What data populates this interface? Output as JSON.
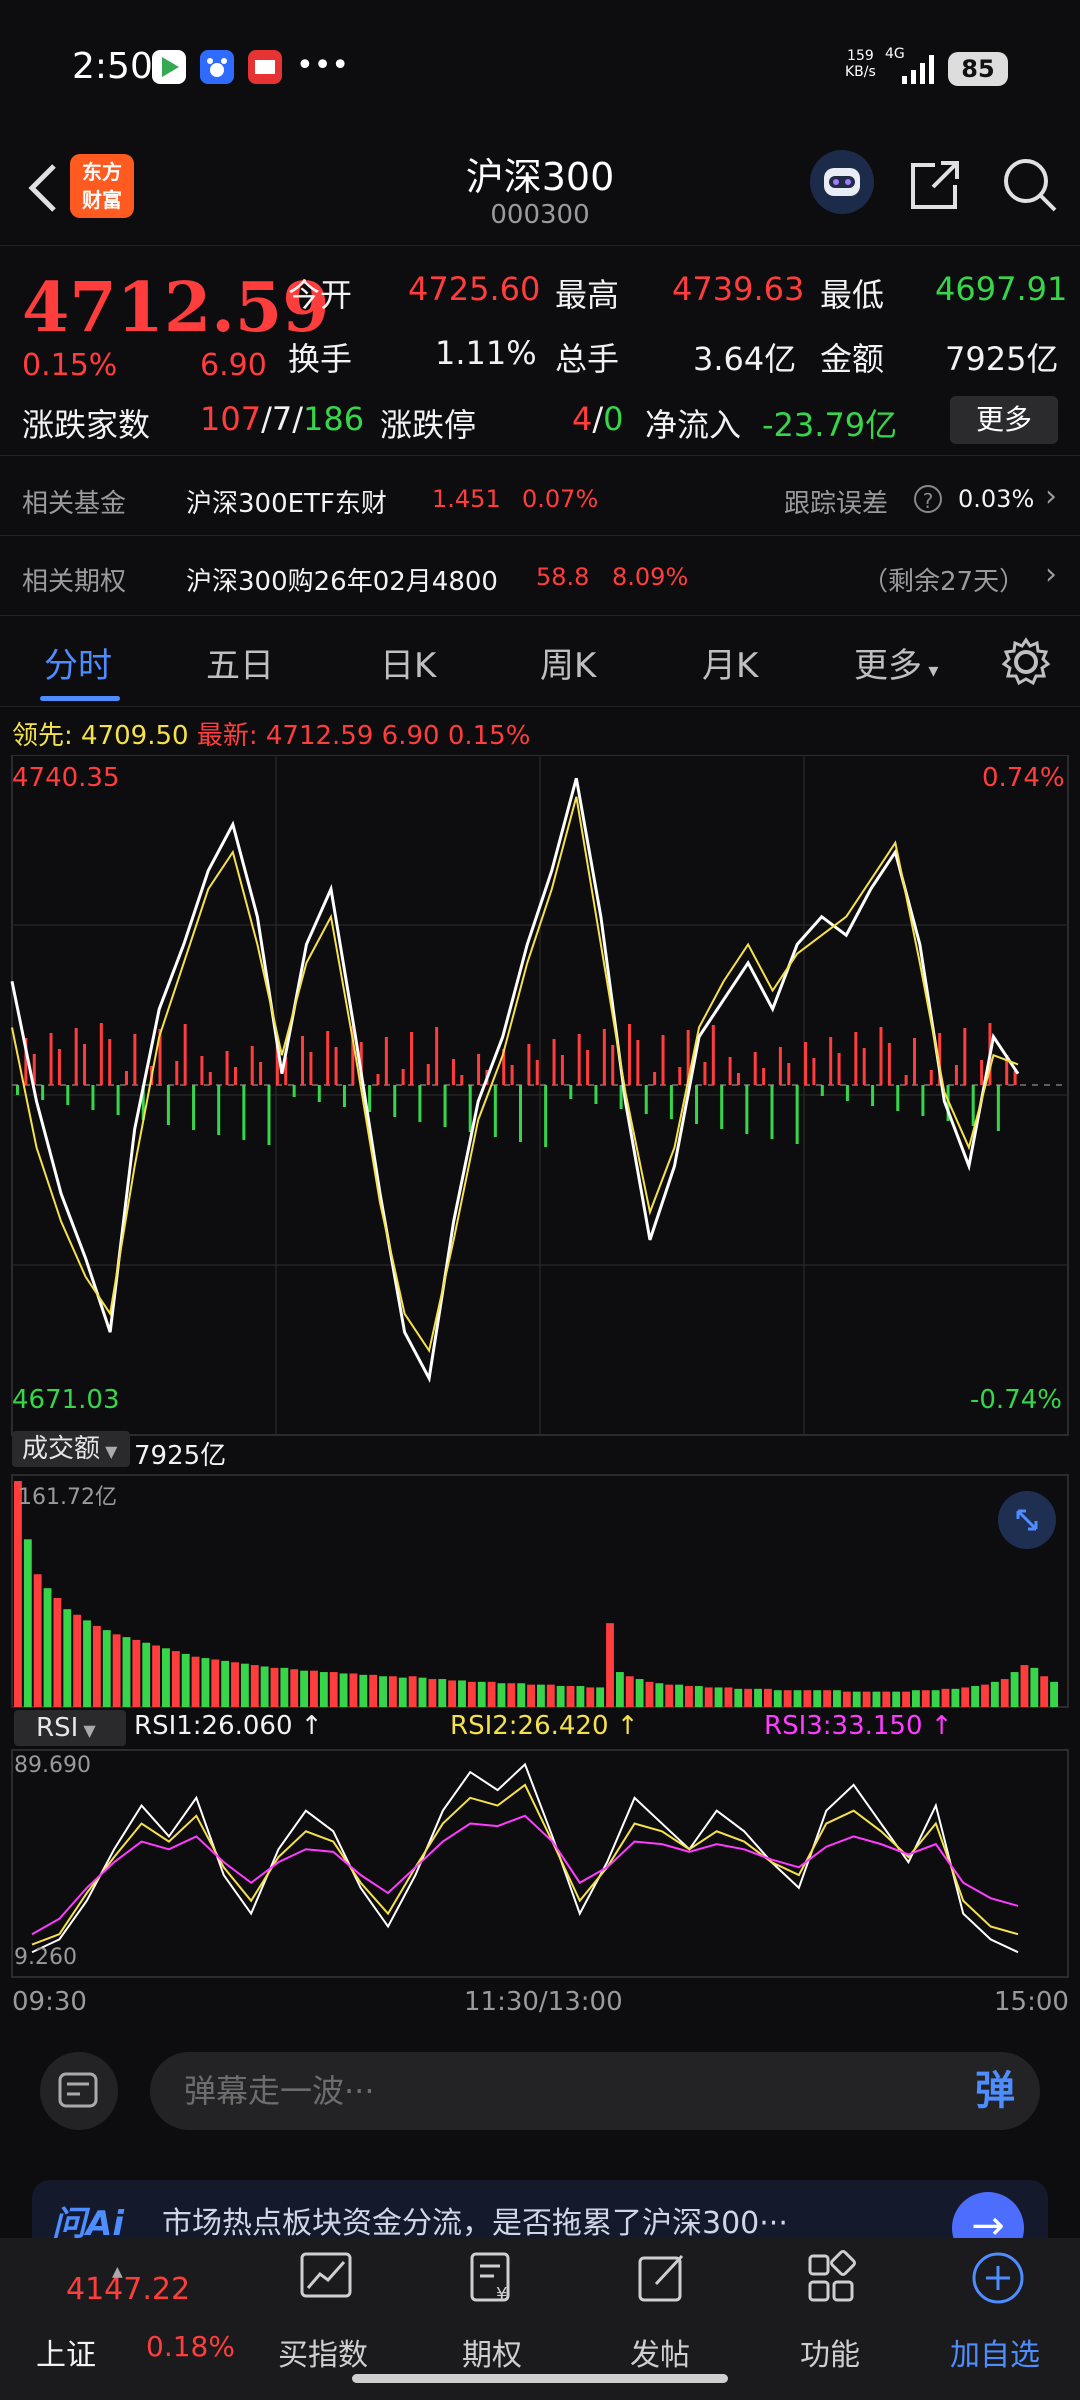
{
  "status_bar": {
    "time": "2:50",
    "net_speed": "159\nKB/s",
    "network": "4G",
    "battery": "85"
  },
  "header": {
    "back_icon": "chevron-left-icon",
    "logo_line1": "东方",
    "logo_line2": "财富",
    "title": "沪深300",
    "code": "000300"
  },
  "quote": {
    "price": "4712.59",
    "pct": "0.15%",
    "change": "6.90",
    "open_label": "今开",
    "open": "4725.60",
    "high_label": "最高",
    "high": "4739.63",
    "low_label": "最低",
    "low": "4697.91",
    "turnover_label": "换手",
    "turnover": "1.11%",
    "volume_label": "总手",
    "volume": "3.64亿",
    "amount_label": "金额",
    "amount": "7925亿",
    "breadth_label": "涨跌家数",
    "breadth_up": "107",
    "breadth_flat": "7",
    "breadth_down": "186",
    "breadth_sep": "/",
    "limit_label": "涨跌停",
    "limit_up": "4",
    "limit_down": "0",
    "netflow_label": "净流入",
    "netflow": "-23.79亿",
    "more_label": "更多"
  },
  "related_fund": {
    "label": "相关基金",
    "name": "沪深300ETF东财",
    "price": "1.451",
    "pct": "0.07%",
    "track_label": "跟踪误差",
    "track": "0.03%"
  },
  "related_option": {
    "label": "相关期权",
    "name": "沪深300购26年02月4800",
    "price": "58.8",
    "pct": "8.09%",
    "remain": "（剩余27天）"
  },
  "tabs": [
    "分时",
    "五日",
    "日K",
    "周K",
    "月K",
    "更多"
  ],
  "intraday": {
    "lead_label": "领先:",
    "lead": "4709.50",
    "latest_label": "最新:",
    "latest": "4712.59",
    "latest_chg": "6.90",
    "latest_pct": "0.15%",
    "top_price": "4740.35",
    "top_pct": "0.74%",
    "bottom_price": "4671.03",
    "bottom_pct": "-0.74%"
  },
  "volume_panel": {
    "select": "成交额",
    "value": "7925亿",
    "max": "161.72亿"
  },
  "rsi_panel": {
    "select": "RSI",
    "rsi1": "RSI1:26.060 ↑",
    "rsi2": "RSI2:26.420 ↑",
    "rsi3": "RSI3:33.150 ↑",
    "max": "89.690",
    "min": "9.260"
  },
  "time_axis": {
    "start": "09:30",
    "mid": "11:30/13:00",
    "end": "15:00"
  },
  "barrage": {
    "placeholder": "弹幕走一波···",
    "button": "弹"
  },
  "ai_banner": {
    "brand": "问Ai",
    "text": "市场热点板块资金分流，是否拖累了沪深300···"
  },
  "bottom_nav": {
    "index_value": "4147.22",
    "index_name": "上证",
    "index_pct": "0.18%",
    "items": [
      "买指数",
      "期权",
      "发帖",
      "功能",
      "加自选"
    ]
  },
  "colors": {
    "up": "#ff3d3d",
    "down": "#37d64a",
    "accent": "#4d8dff",
    "avg_line": "#f5e14b",
    "rsi3": "#ff3cff"
  },
  "chart_data": [
    {
      "type": "line",
      "title": "",
      "ylim": [
        4671.03,
        4740.35
      ],
      "x_range": [
        "09:30",
        "15:00"
      ],
      "series": [
        {
          "name": "",
          "values": [
            4718,
            4705,
            4695,
            4688,
            4680,
            4702,
            4715,
            4722,
            4730,
            4735,
            4725,
            4708,
            4722,
            4728,
            4712,
            4695,
            4680,
            4675,
            4692,
            4705,
            4712,
            4722,
            4730,
            4740,
            4725,
            4705,
            4690,
            4698,
            4712,
            4716,
            4720,
            4715,
            4722,
            4725,
            4723,
            4728,
            4732,
            4722,
            4705,
            4698,
            4712,
            4708
          ]
        },
        {
          "name": "",
          "values": [
            4713,
            4700,
            4692,
            4686,
            4682,
            4698,
            4712,
            4720,
            4728,
            4732,
            4722,
            4710,
            4720,
            4725,
            4710,
            4694,
            4682,
            4678,
            4690,
            4703,
            4710,
            4720,
            4728,
            4738,
            4722,
            4706,
            4693,
            4700,
            4713,
            4718,
            4722,
            4717,
            4721,
            4723,
            4725,
            4729,
            4733,
            4720,
            4706,
            4700,
            4710,
            4709
          ]
        }
      ]
    },
    {
      "type": "bar",
      "title": "",
      "ylabel": "",
      "ylim": [
        0,
        161.72
      ],
      "values": [
        161.7,
        120,
        95,
        85,
        78,
        70,
        66,
        62,
        58,
        55,
        52,
        50,
        48,
        46,
        44,
        42,
        40,
        38,
        36,
        35,
        34,
        33,
        32,
        31,
        30,
        29,
        28,
        28,
        27,
        26,
        26,
        25,
        25,
        24,
        24,
        23,
        23,
        22,
        22,
        21,
        22,
        21,
        20,
        20,
        19,
        19,
        18,
        18,
        18,
        17,
        17,
        17,
        16,
        16,
        16,
        15,
        15,
        15,
        14,
        14,
        60,
        25,
        22,
        20,
        18,
        17,
        16,
        16,
        15,
        15,
        14,
        14,
        14,
        13,
        13,
        13,
        13,
        12,
        12,
        12,
        12,
        12,
        12,
        12,
        11,
        11,
        11,
        11,
        11,
        11,
        11,
        12,
        12,
        12,
        13,
        13,
        14,
        15,
        16,
        18,
        20,
        25,
        30,
        28,
        22,
        18
      ]
    },
    {
      "type": "line",
      "title": "",
      "ylim": [
        9.26,
        89.69
      ],
      "series": [
        {
          "name": "RSI1",
          "values": [
            15,
            20,
            35,
            55,
            72,
            60,
            75,
            45,
            30,
            55,
            70,
            62,
            40,
            25,
            45,
            70,
            85,
            78,
            88,
            60,
            30,
            50,
            75,
            65,
            55,
            70,
            62,
            50,
            40,
            70,
            80,
            65,
            50,
            72,
            30,
            20,
            15
          ]
        },
        {
          "name": "RSI2",
          "values": [
            18,
            22,
            38,
            52,
            65,
            58,
            68,
            48,
            35,
            52,
            62,
            58,
            42,
            30,
            48,
            65,
            75,
            72,
            80,
            58,
            35,
            48,
            65,
            62,
            55,
            62,
            58,
            50,
            45,
            65,
            70,
            62,
            52,
            65,
            35,
            25,
            22
          ]
        },
        {
          "name": "RSI3",
          "values": [
            22,
            28,
            40,
            50,
            58,
            55,
            60,
            50,
            42,
            50,
            55,
            54,
            45,
            38,
            48,
            58,
            65,
            64,
            68,
            58,
            42,
            48,
            58,
            57,
            54,
            57,
            55,
            51,
            48,
            56,
            60,
            57,
            53,
            57,
            42,
            36,
            33
          ]
        }
      ]
    }
  ]
}
